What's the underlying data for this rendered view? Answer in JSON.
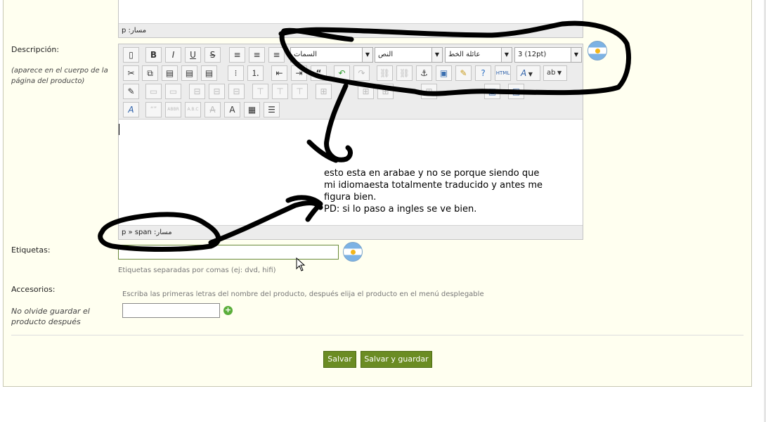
{
  "editor_top": {
    "path_text": "مسار: p"
  },
  "description": {
    "label": "Descripción:",
    "hint": "(aparece en el cuerpo de la página del producto)",
    "style_select": "السمات",
    "format_select": "النص",
    "font_select": "عائلة الخط",
    "size_select": "3 (12pt)",
    "path_text": "مسار: p » span"
  },
  "toolbar_icons": [
    "new-document-icon",
    "bold-icon",
    "italic-icon",
    "underline-icon",
    "strikethrough-icon",
    "align-left-icon",
    "align-center-icon",
    "align-right-icon",
    "cut-icon",
    "copy-icon",
    "paste-icon",
    "paste-text-icon",
    "paste-word-icon",
    "bullet-list-icon",
    "numbered-list-icon",
    "outdent-icon",
    "indent-icon",
    "blockquote-icon",
    "undo-icon",
    "redo-icon",
    "link-icon",
    "unlink-icon",
    "anchor-icon",
    "image-icon",
    "cleanup-icon",
    "help-icon",
    "html-icon",
    "text-color-icon",
    "highlight-color-icon"
  ],
  "note": {
    "lines": [
      "esto esta en arabae y no se porque siendo que",
      "mi idiomaesta totalmente traducido y antes me",
      "figura bien.",
      "PD: si lo paso a ingles se ve bien."
    ]
  },
  "tags": {
    "label": "Etiquetas:",
    "value": "",
    "help": "Etiquetas separadas por comas (ej: dvd, hifi)"
  },
  "accessories": {
    "label": "Accesorios:",
    "help": "Escriba las primeras letras del nombre del producto, después elija el producto en el menú desplegable",
    "note": "No olvide guardar el producto después",
    "add_symbol": "+"
  },
  "buttons": {
    "save": "Salvar",
    "save_and_stay": "Salvar y guardar"
  },
  "colors": {
    "panel_bg": "#fffff0",
    "button_green": "#6b8c23",
    "scribble": "#000000"
  }
}
